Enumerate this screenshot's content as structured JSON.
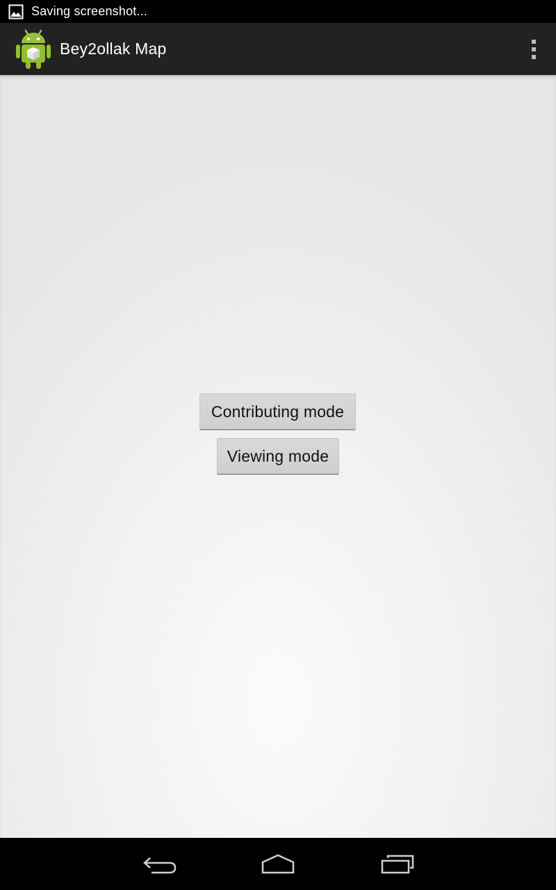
{
  "status_bar": {
    "notification_icon": "image-icon",
    "notification_text": "Saving screenshot..."
  },
  "action_bar": {
    "app_icon": "android-robot-icon",
    "title": "Bey2ollak Map",
    "overflow_icon": "overflow-menu-icon"
  },
  "main": {
    "buttons": [
      {
        "label": "Contributing mode"
      },
      {
        "label": "Viewing mode"
      }
    ]
  },
  "nav_bar": {
    "back_icon": "back-icon",
    "home_icon": "home-icon",
    "recents_icon": "recent-apps-icon"
  },
  "colors": {
    "action_bar_bg": "#222222",
    "status_bar_bg": "#000000",
    "content_bg": "#eeeeee",
    "android_green": "#a4c639"
  }
}
